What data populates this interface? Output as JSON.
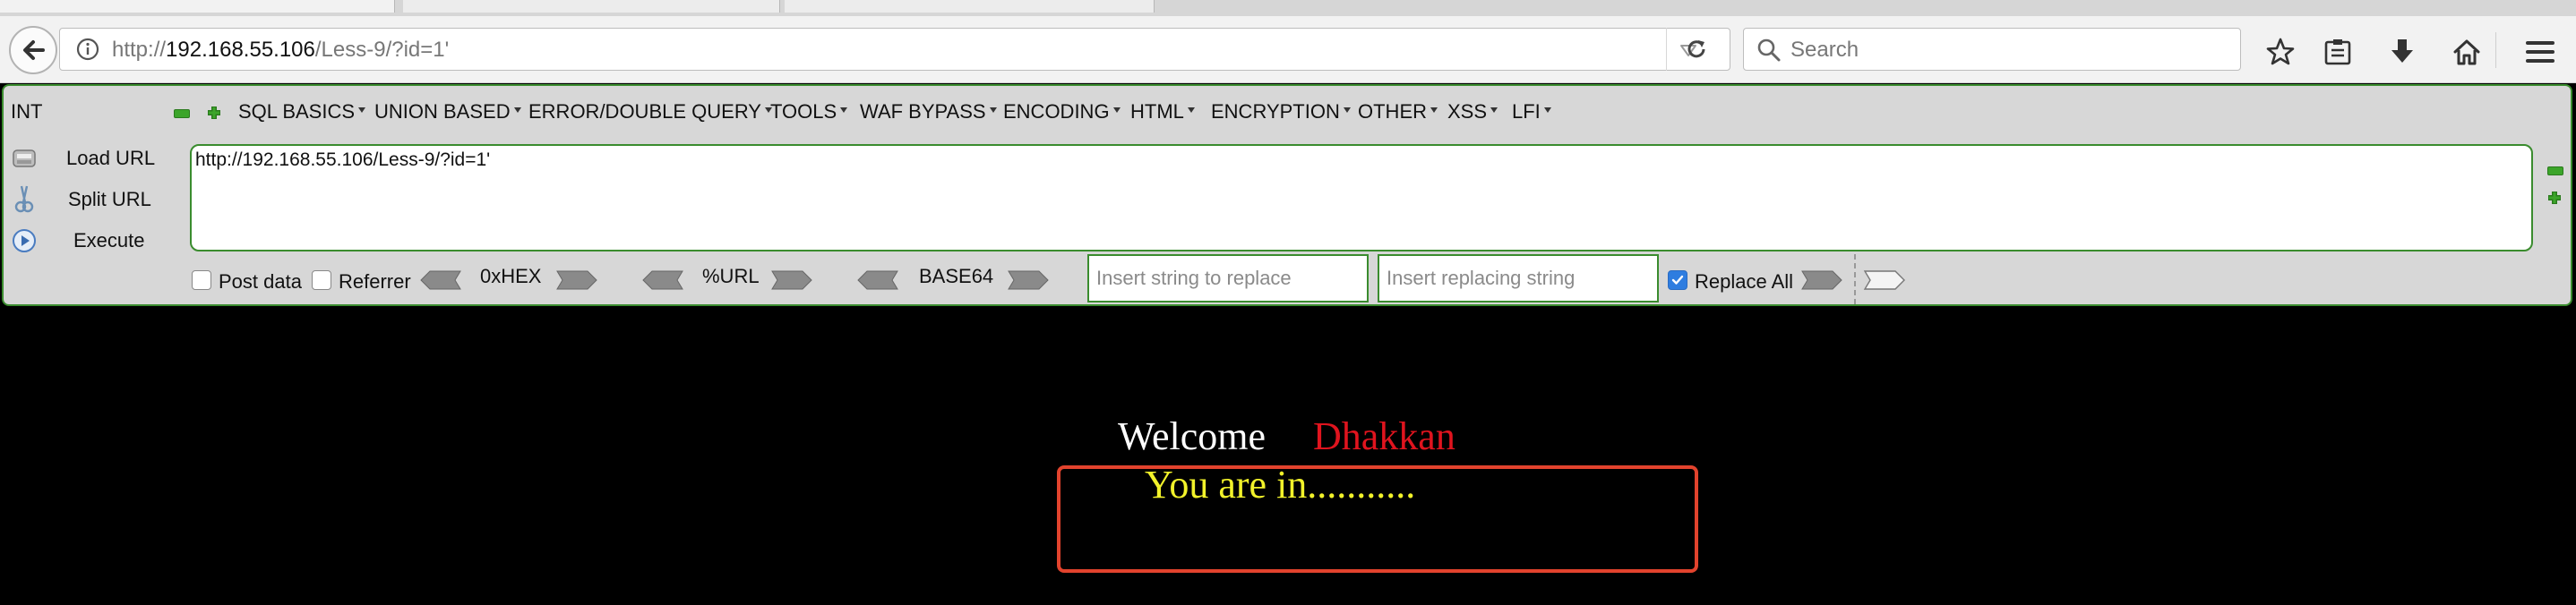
{
  "browser": {
    "url_scheme": "http://",
    "url_host": "192.168.55.106",
    "url_path": "/Less-9/?id=1'",
    "search_placeholder": "Search"
  },
  "hackbar": {
    "mode": "INT",
    "menu": [
      "SQL BASICS",
      "UNION BASED",
      "ERROR/DOUBLE QUERY",
      "TOOLS",
      "WAF BYPASS",
      "ENCODING",
      "HTML",
      "ENCRYPTION",
      "OTHER",
      "XSS",
      "LFI"
    ],
    "actions": {
      "load": "Load URL",
      "split": "Split URL",
      "execute": "Execute"
    },
    "url_value": "http://192.168.55.106/Less-9/?id=1'",
    "post_data_label": "Post data",
    "referrer_label": "Referrer",
    "hex_label": "0xHEX",
    "url_enc_label": "%URL",
    "base64_label": "BASE64",
    "replace_placeholder": "Insert string to replace",
    "replacing_placeholder": "Insert replacing string",
    "replace_all_label": "Replace All",
    "post_data_checked": false,
    "referrer_checked": false,
    "replace_all_checked": true
  },
  "page": {
    "welcome": "Welcome",
    "username": "Dhakkan",
    "status": "You are in..........."
  },
  "colors": {
    "hackbar_border": "#3a8c2e",
    "username": "#e0141e",
    "status": "#f2f22a",
    "highlight_box": "#e2432d"
  }
}
